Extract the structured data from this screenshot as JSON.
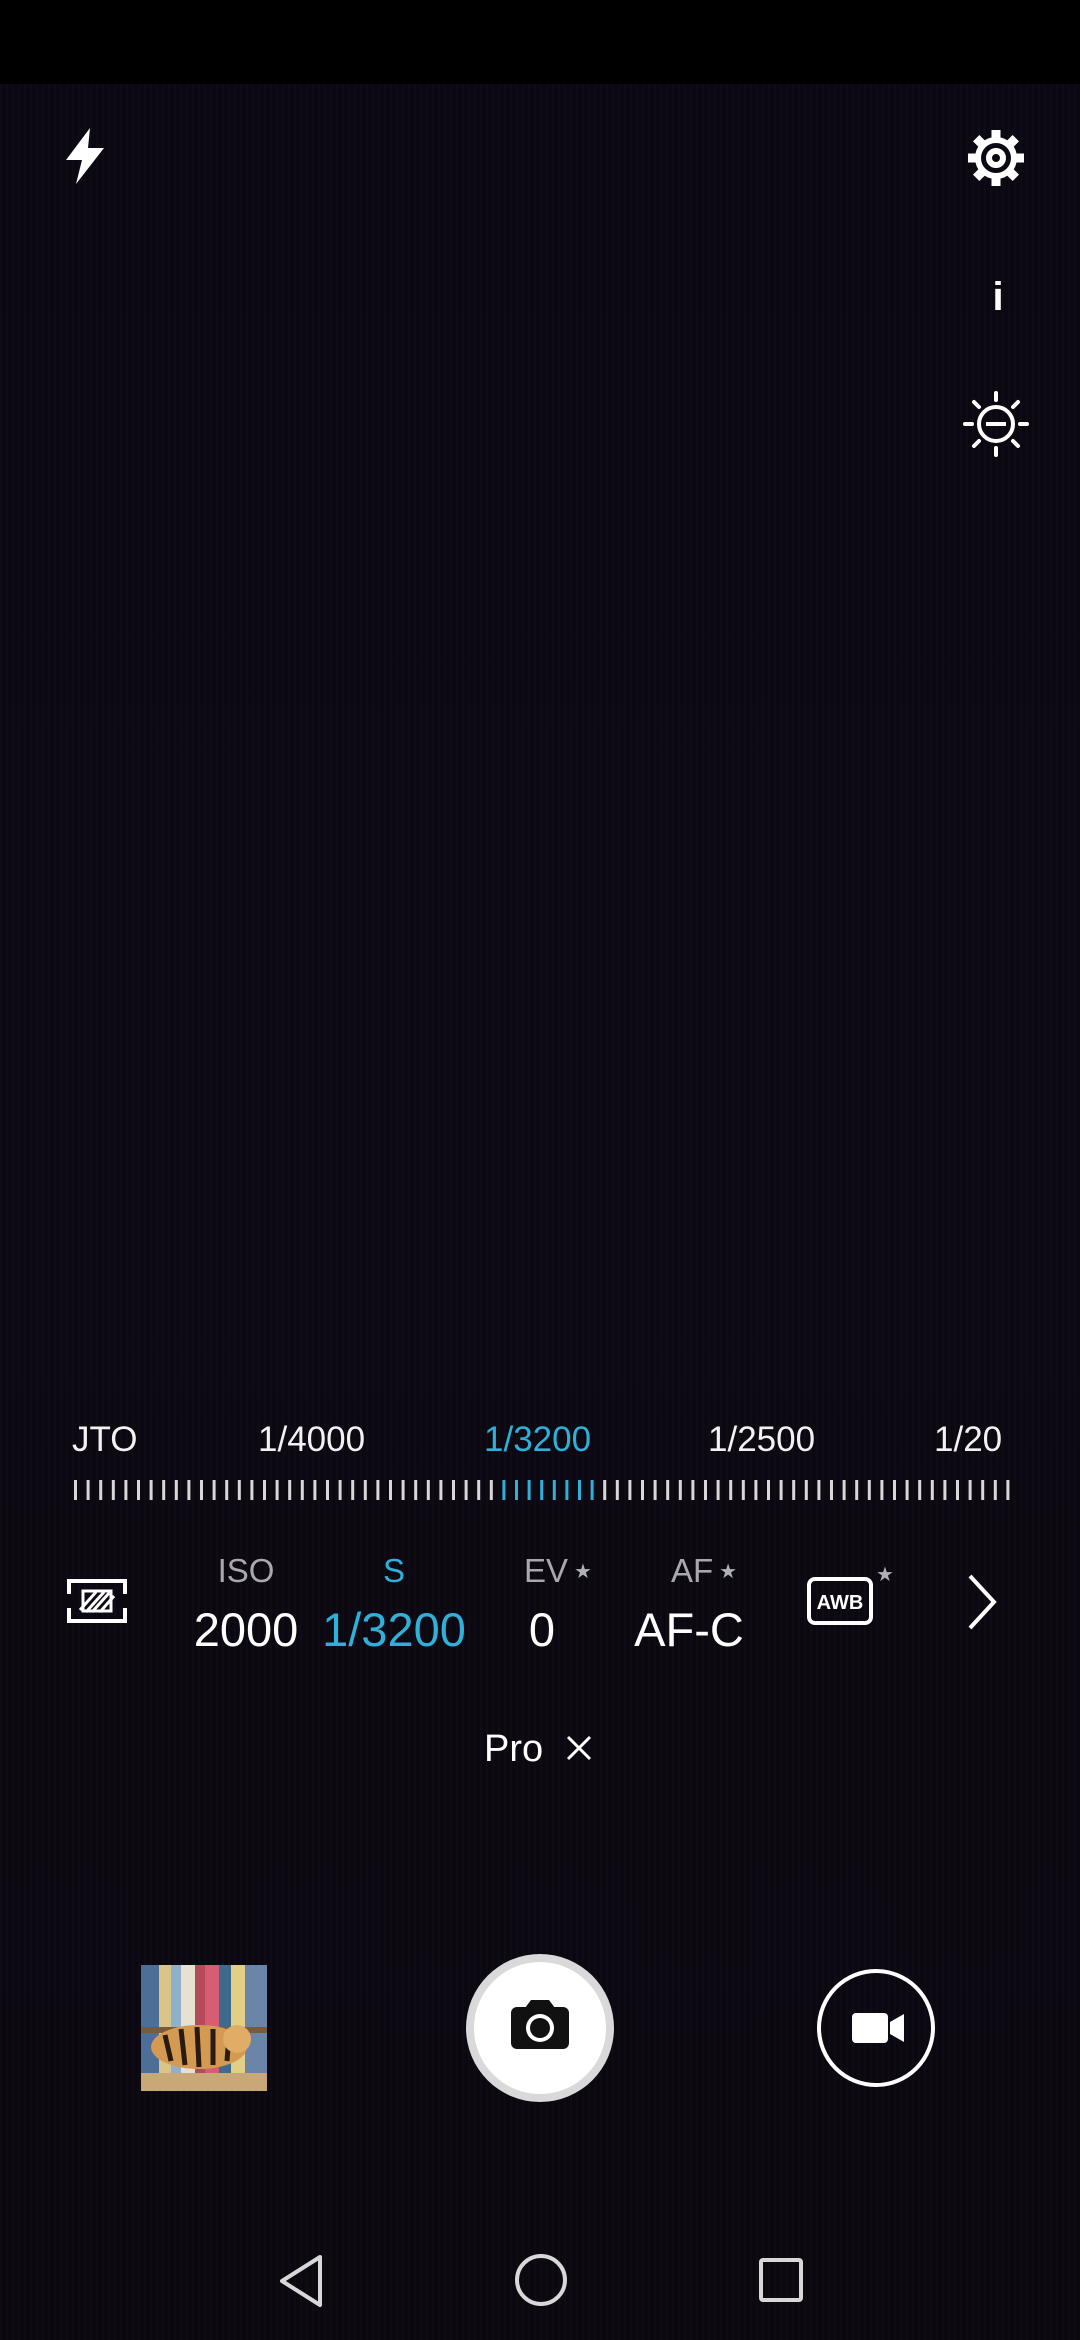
{
  "scale": {
    "labels": [
      "JTO",
      "1/4000",
      "1/3200",
      "1/2500",
      "1/20"
    ],
    "selected": "1/3200"
  },
  "params": {
    "iso": {
      "title": "ISO",
      "value": "2000"
    },
    "shutter": {
      "title": "S",
      "value": "1/3200"
    },
    "ev": {
      "title": "EV",
      "value": "0"
    },
    "af": {
      "title": "AF",
      "value": "AF-C"
    },
    "awb": {
      "label": "AWB"
    }
  },
  "mode": {
    "label": "Pro"
  },
  "top": {
    "info_label": "i"
  },
  "icons": {
    "flash": "flash-icon",
    "settings": "gear-icon",
    "exposure": "exposure-compensation-icon",
    "metering": "metering-icon",
    "more": "chevron-right-icon",
    "shutter": "camera-icon",
    "video": "video-camera-icon"
  },
  "colors": {
    "accent": "#2fb0d8",
    "background": "#0b0810"
  }
}
